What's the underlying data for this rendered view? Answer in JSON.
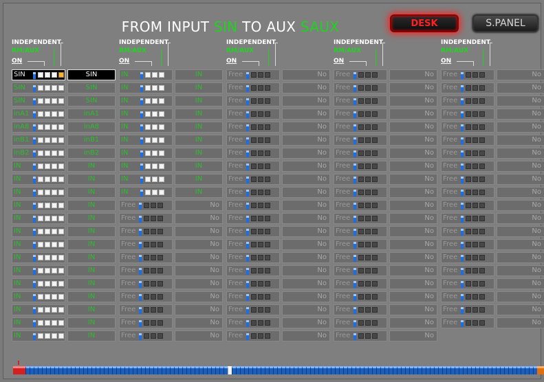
{
  "header": {
    "title_prefix": "FROM INPUT",
    "title_input": "SIN",
    "title_mid": "TO AUX",
    "title_aux": "SAUX",
    "desk_label": "DESK",
    "spanel_label": "S.PANEL"
  },
  "column_header": {
    "independent": "INDEPENDENT",
    "rm": "RM/AUX",
    "on": "ON"
  },
  "colors": {
    "accent_green": "#1dd51d",
    "desk_red": "#ff2020",
    "panel_gray": "#7f7f7f"
  },
  "columns": [
    {
      "rows": [
        {
          "label": "SIN",
          "value": "SIN",
          "active": true,
          "green": false,
          "squares": "wwwy"
        },
        {
          "label": "SIN",
          "value": "SIN",
          "active": false,
          "green": true,
          "squares": "wwww"
        },
        {
          "label": "SIN",
          "value": "SIN",
          "active": false,
          "green": true,
          "squares": "wwww"
        },
        {
          "label": "inA1",
          "value": "inA1",
          "active": false,
          "green": true,
          "squares": "wwww"
        },
        {
          "label": "inA8",
          "value": "inA8",
          "active": false,
          "green": true,
          "squares": "wwww"
        },
        {
          "label": "inB1",
          "value": "inB1",
          "active": false,
          "green": true,
          "squares": "wwww"
        },
        {
          "label": "inB2",
          "value": "inB2",
          "active": false,
          "green": true,
          "squares": "wwww"
        },
        {
          "label": "IN",
          "value": "IN",
          "active": false,
          "green": true,
          "squares": "wwww"
        },
        {
          "label": "IN",
          "value": "IN",
          "active": false,
          "green": true,
          "squares": "wwww"
        },
        {
          "label": "IN",
          "value": "IN",
          "active": false,
          "green": true,
          "squares": "wwww"
        },
        {
          "label": "IN",
          "value": "IN",
          "active": false,
          "green": true,
          "squares": "wwww"
        },
        {
          "label": "IN",
          "value": "IN",
          "active": false,
          "green": true,
          "squares": "wwww"
        },
        {
          "label": "IN",
          "value": "IN",
          "active": false,
          "green": true,
          "squares": "wwww"
        },
        {
          "label": "IN",
          "value": "IN",
          "active": false,
          "green": true,
          "squares": "wwww"
        },
        {
          "label": "IN",
          "value": "IN",
          "active": false,
          "green": true,
          "squares": "wwww"
        },
        {
          "label": "IN",
          "value": "IN",
          "active": false,
          "green": true,
          "squares": "wwww"
        },
        {
          "label": "IN",
          "value": "IN",
          "active": false,
          "green": true,
          "squares": "wwww"
        },
        {
          "label": "IN",
          "value": "IN",
          "active": false,
          "green": true,
          "squares": "wwww"
        },
        {
          "label": "IN",
          "value": "IN",
          "active": false,
          "green": true,
          "squares": "wwww"
        },
        {
          "label": "IN",
          "value": "IN",
          "active": false,
          "green": true,
          "squares": "wwww"
        },
        {
          "label": "IN",
          "value": "IN",
          "active": false,
          "green": true,
          "squares": "wwww"
        }
      ]
    },
    {
      "rows": [
        {
          "label": "IN",
          "value": "IN",
          "active": false,
          "green": true,
          "squares": "www"
        },
        {
          "label": "IN",
          "value": "IN",
          "active": false,
          "green": true,
          "squares": "www"
        },
        {
          "label": "IN",
          "value": "IN",
          "active": false,
          "green": true,
          "squares": "www"
        },
        {
          "label": "IN",
          "value": "IN",
          "active": false,
          "green": true,
          "squares": "www"
        },
        {
          "label": "IN",
          "value": "IN",
          "active": false,
          "green": true,
          "squares": "www"
        },
        {
          "label": "IN",
          "value": "IN",
          "active": false,
          "green": true,
          "squares": "www"
        },
        {
          "label": "IN",
          "value": "IN",
          "active": false,
          "green": true,
          "squares": "www"
        },
        {
          "label": "IN",
          "value": "IN",
          "active": false,
          "green": true,
          "squares": "www"
        },
        {
          "label": "IN",
          "value": "IN",
          "active": false,
          "green": true,
          "squares": "www"
        },
        {
          "label": "IN",
          "value": "IN",
          "active": false,
          "green": true,
          "squares": "www"
        },
        {
          "label": "Free",
          "value": "No",
          "active": false,
          "green": false,
          "squares": "ddd"
        },
        {
          "label": "Free",
          "value": "No",
          "active": false,
          "green": false,
          "squares": "ddd"
        },
        {
          "label": "Free",
          "value": "No",
          "active": false,
          "green": false,
          "squares": "ddd"
        },
        {
          "label": "Free",
          "value": "No",
          "active": false,
          "green": false,
          "squares": "ddd"
        },
        {
          "label": "Free",
          "value": "No",
          "active": false,
          "green": false,
          "squares": "ddd"
        },
        {
          "label": "Free",
          "value": "No",
          "active": false,
          "green": false,
          "squares": "ddd"
        },
        {
          "label": "Free",
          "value": "No",
          "active": false,
          "green": false,
          "squares": "ddd"
        },
        {
          "label": "Free",
          "value": "No",
          "active": false,
          "green": false,
          "squares": "ddd"
        },
        {
          "label": "Free",
          "value": "No",
          "active": false,
          "green": false,
          "squares": "ddd"
        },
        {
          "label": "Free",
          "value": "No",
          "active": false,
          "green": false,
          "squares": "ddd"
        },
        {
          "label": "Free",
          "value": "No",
          "active": false,
          "green": false,
          "squares": "ddd"
        }
      ]
    },
    {
      "rows": [
        {
          "label": "Free",
          "value": "No",
          "active": false,
          "green": false,
          "squares": "ddd"
        },
        {
          "label": "Free",
          "value": "No",
          "active": false,
          "green": false,
          "squares": "ddd"
        },
        {
          "label": "Free",
          "value": "No",
          "active": false,
          "green": false,
          "squares": "ddd"
        },
        {
          "label": "Free",
          "value": "No",
          "active": false,
          "green": false,
          "squares": "ddd"
        },
        {
          "label": "Free",
          "value": "No",
          "active": false,
          "green": false,
          "squares": "ddd"
        },
        {
          "label": "Free",
          "value": "No",
          "active": false,
          "green": false,
          "squares": "ddd"
        },
        {
          "label": "Free",
          "value": "No",
          "active": false,
          "green": false,
          "squares": "ddd"
        },
        {
          "label": "Free",
          "value": "No",
          "active": false,
          "green": false,
          "squares": "ddd"
        },
        {
          "label": "Free",
          "value": "No",
          "active": false,
          "green": false,
          "squares": "ddd"
        },
        {
          "label": "Free",
          "value": "No",
          "active": false,
          "green": false,
          "squares": "ddd"
        },
        {
          "label": "Free",
          "value": "No",
          "active": false,
          "green": false,
          "squares": "ddd"
        },
        {
          "label": "Free",
          "value": "No",
          "active": false,
          "green": false,
          "squares": "ddd"
        },
        {
          "label": "Free",
          "value": "No",
          "active": false,
          "green": false,
          "squares": "ddd"
        },
        {
          "label": "Free",
          "value": "No",
          "active": false,
          "green": false,
          "squares": "ddd"
        },
        {
          "label": "Free",
          "value": "No",
          "active": false,
          "green": false,
          "squares": "ddd"
        },
        {
          "label": "Free",
          "value": "No",
          "active": false,
          "green": false,
          "squares": "ddd"
        },
        {
          "label": "Free",
          "value": "No",
          "active": false,
          "green": false,
          "squares": "ddd"
        },
        {
          "label": "Free",
          "value": "No",
          "active": false,
          "green": false,
          "squares": "ddd"
        },
        {
          "label": "Free",
          "value": "No",
          "active": false,
          "green": false,
          "squares": "ddd"
        },
        {
          "label": "Free",
          "value": "No",
          "active": false,
          "green": false,
          "squares": "ddd"
        },
        {
          "label": "Free",
          "value": "No",
          "active": false,
          "green": false,
          "squares": "ddd"
        }
      ]
    },
    {
      "rows": [
        {
          "label": "Free",
          "value": "No",
          "active": false,
          "green": false,
          "squares": "ddd"
        },
        {
          "label": "Free",
          "value": "No",
          "active": false,
          "green": false,
          "squares": "ddd"
        },
        {
          "label": "Free",
          "value": "No",
          "active": false,
          "green": false,
          "squares": "ddd"
        },
        {
          "label": "Free",
          "value": "No",
          "active": false,
          "green": false,
          "squares": "ddd"
        },
        {
          "label": "Free",
          "value": "No",
          "active": false,
          "green": false,
          "squares": "ddd"
        },
        {
          "label": "Free",
          "value": "No",
          "active": false,
          "green": false,
          "squares": "ddd"
        },
        {
          "label": "Free",
          "value": "No",
          "active": false,
          "green": false,
          "squares": "ddd"
        },
        {
          "label": "Free",
          "value": "No",
          "active": false,
          "green": false,
          "squares": "ddd"
        },
        {
          "label": "Free",
          "value": "No",
          "active": false,
          "green": false,
          "squares": "ddd"
        },
        {
          "label": "Free",
          "value": "No",
          "active": false,
          "green": false,
          "squares": "ddd"
        },
        {
          "label": "Free",
          "value": "No",
          "active": false,
          "green": false,
          "squares": "ddd"
        },
        {
          "label": "Free",
          "value": "No",
          "active": false,
          "green": false,
          "squares": "ddd"
        },
        {
          "label": "Free",
          "value": "No",
          "active": false,
          "green": false,
          "squares": "ddd"
        },
        {
          "label": "Free",
          "value": "No",
          "active": false,
          "green": false,
          "squares": "ddd"
        },
        {
          "label": "Free",
          "value": "No",
          "active": false,
          "green": false,
          "squares": "ddd"
        },
        {
          "label": "Free",
          "value": "No",
          "active": false,
          "green": false,
          "squares": "ddd"
        },
        {
          "label": "Free",
          "value": "No",
          "active": false,
          "green": false,
          "squares": "ddd"
        },
        {
          "label": "Free",
          "value": "No",
          "active": false,
          "green": false,
          "squares": "ddd"
        },
        {
          "label": "Free",
          "value": "No",
          "active": false,
          "green": false,
          "squares": "ddd"
        },
        {
          "label": "Free",
          "value": "No",
          "active": false,
          "green": false,
          "squares": "ddd"
        },
        {
          "label": "Free",
          "value": "No",
          "active": false,
          "green": false,
          "squares": "ddd"
        }
      ]
    },
    {
      "rows": [
        {
          "label": "Free",
          "value": "No",
          "active": false,
          "green": false,
          "squares": "ddd"
        },
        {
          "label": "Free",
          "value": "No",
          "active": false,
          "green": false,
          "squares": "ddd"
        },
        {
          "label": "Free",
          "value": "No",
          "active": false,
          "green": false,
          "squares": "ddd"
        },
        {
          "label": "Free",
          "value": "No",
          "active": false,
          "green": false,
          "squares": "ddd"
        },
        {
          "label": "Free",
          "value": "No",
          "active": false,
          "green": false,
          "squares": "ddd"
        },
        {
          "label": "Free",
          "value": "No",
          "active": false,
          "green": false,
          "squares": "ddd"
        },
        {
          "label": "Free",
          "value": "No",
          "active": false,
          "green": false,
          "squares": "ddd"
        },
        {
          "label": "Free",
          "value": "No",
          "active": false,
          "green": false,
          "squares": "ddd"
        },
        {
          "label": "Free",
          "value": "No",
          "active": false,
          "green": false,
          "squares": "ddd"
        },
        {
          "label": "Free",
          "value": "No",
          "active": false,
          "green": false,
          "squares": "ddd"
        },
        {
          "label": "Free",
          "value": "No",
          "active": false,
          "green": false,
          "squares": "ddd"
        },
        {
          "label": "Free",
          "value": "No",
          "active": false,
          "green": false,
          "squares": "ddd"
        },
        {
          "label": "Free",
          "value": "No",
          "active": false,
          "green": false,
          "squares": "ddd"
        },
        {
          "label": "Free",
          "value": "No",
          "active": false,
          "green": false,
          "squares": "ddd"
        },
        {
          "label": "Free",
          "value": "No",
          "active": false,
          "green": false,
          "squares": "ddd"
        },
        {
          "label": "Free",
          "value": "No",
          "active": false,
          "green": false,
          "squares": "ddd"
        },
        {
          "label": "Free",
          "value": "No",
          "active": false,
          "green": false,
          "squares": "ddd"
        },
        {
          "label": "Free",
          "value": "No",
          "active": false,
          "green": false,
          "squares": "ddd"
        },
        {
          "label": "Free",
          "value": "No",
          "active": false,
          "green": false,
          "squares": "ddd"
        },
        {
          "label": "Free",
          "value": "No",
          "active": false,
          "green": false,
          "squares": "ddd"
        }
      ]
    }
  ],
  "bottom_strip": "rrrbbbbbbbbbbbbbbbbbbbbbbbbbbbbbbbbbbbbbbbbbbbbbbbbbwbbbbbbbbbbbbbbbbbbbbbbbbbbbbbbbbbbbbbbbbbbbbbbbbbbbbbbbbbbbbbbbbbbbbbbbbbboo"
}
